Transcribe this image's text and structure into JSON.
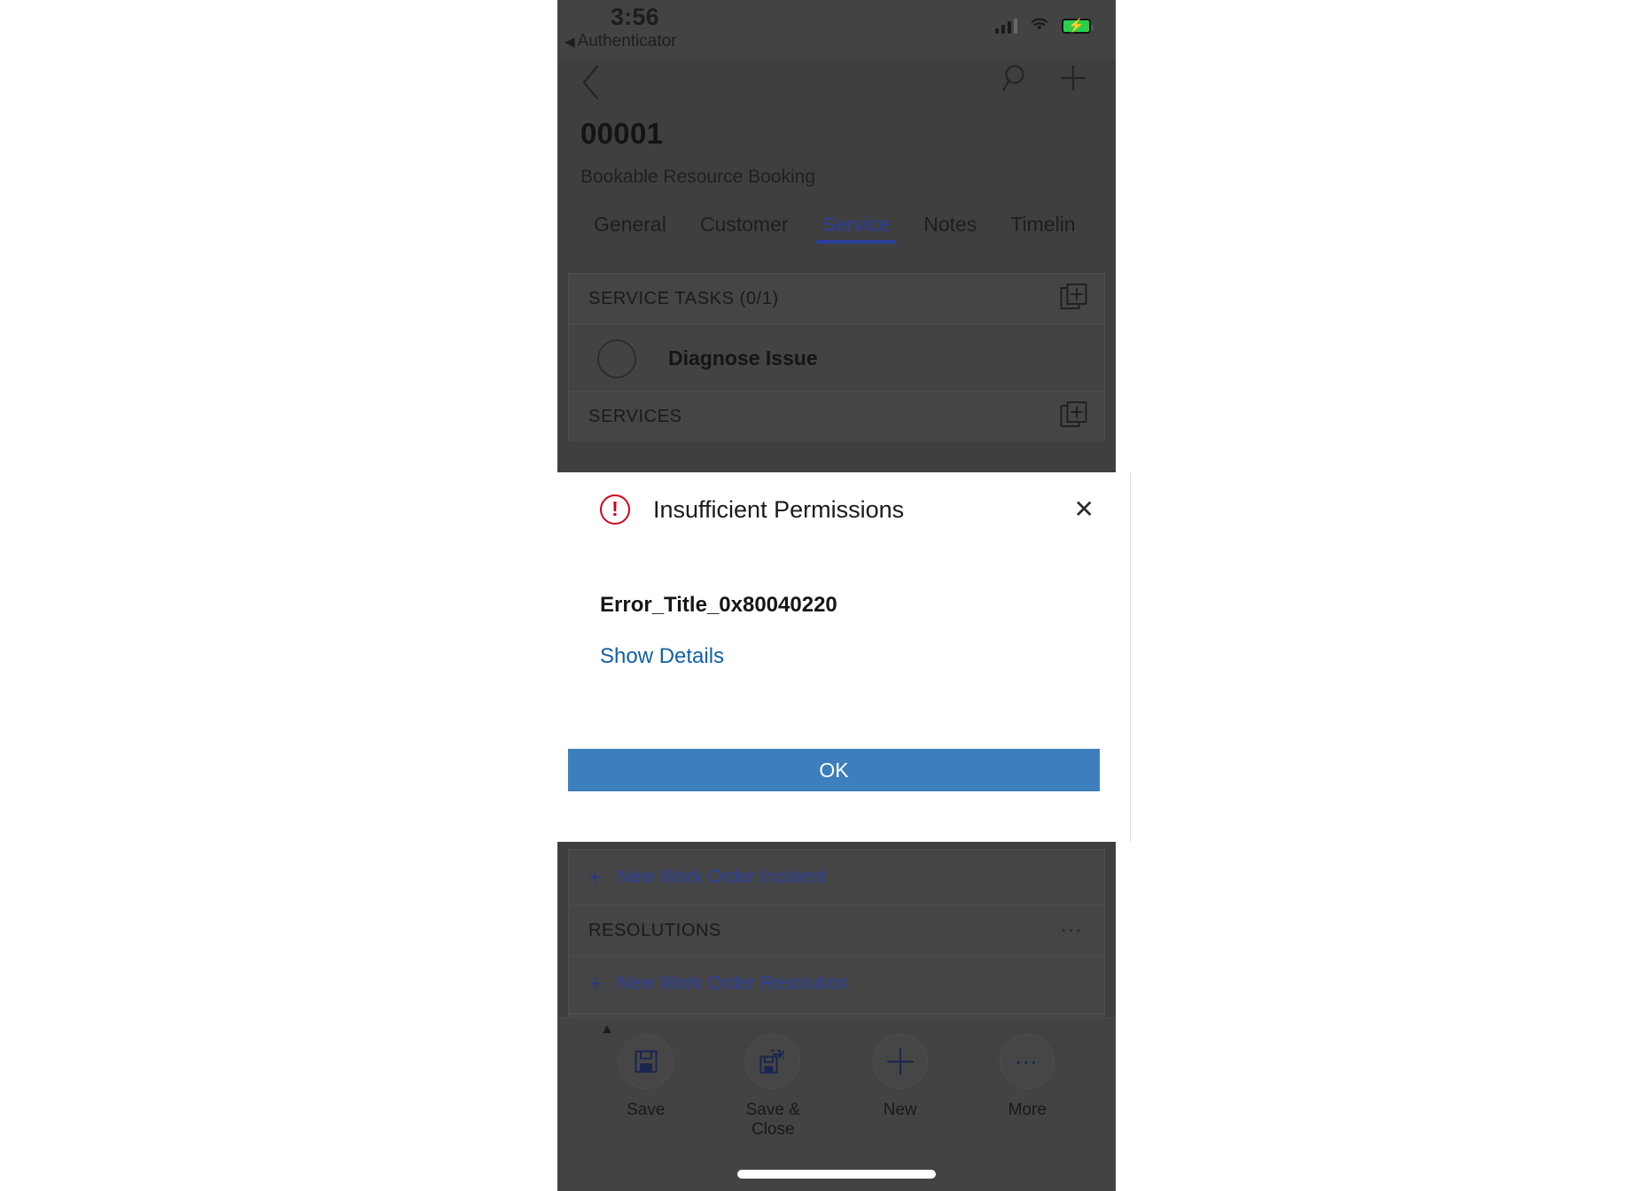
{
  "status_bar": {
    "time": "3:56",
    "back_app_label": "Authenticator",
    "back_triangle": "◀",
    "signal_icon": "signal-bars-icon",
    "wifi_icon": "wifi-icon",
    "battery_icon": "battery-charging-icon",
    "battery_color": "#2bd04a"
  },
  "command_icons": {
    "back": "‹",
    "search": "search-icon",
    "new": "+"
  },
  "record": {
    "title": "00001",
    "entity": "Bookable Resource Booking"
  },
  "tabs": [
    {
      "label": "General",
      "active": false
    },
    {
      "label": "Customer",
      "active": false
    },
    {
      "label": "Service",
      "active": true
    },
    {
      "label": "Notes",
      "active": false
    },
    {
      "label": "Timelin",
      "active": false
    }
  ],
  "sections": {
    "service_tasks": {
      "header": "SERVICE TASKS (0/1)",
      "add_icon": "add-existing-record-icon",
      "rows": [
        {
          "label": "Diagnose Issue",
          "completed": false
        }
      ]
    },
    "services": {
      "header": "SERVICES",
      "add_icon": "add-existing-record-icon"
    },
    "incidents": {
      "new_link": "New Work Order Incident",
      "plus": "+"
    },
    "resolutions": {
      "header": "RESOLUTIONS",
      "more_icon": "ellipsis-icon",
      "new_link": "New Work Order Resolution",
      "plus": "+"
    }
  },
  "dialog": {
    "error_icon": "error-exclamation-icon",
    "error_icon_color": "#d0021b",
    "title": "Insufficient Permissions",
    "close_icon": "✕",
    "error_code": "Error_Title_0x80040220",
    "details_link": "Show Details",
    "ok_label": "OK",
    "ok_color": "#3d7ebc",
    "link_color": "#1160a8"
  },
  "bottom_bar": {
    "expand_icon": "chevron-up-icon",
    "items": [
      {
        "label": "Save",
        "icon": "save-floppy-icon"
      },
      {
        "label": "Save & Close",
        "icon": "save-and-close-icon"
      },
      {
        "label": "New",
        "icon": "plus-icon"
      },
      {
        "label": "More",
        "icon": "ellipsis-icon"
      }
    ],
    "home_indicator": "home-indicator"
  },
  "accent_colors": {
    "tab_active": "#2b3f9e",
    "link": "#2b3f9e",
    "dialog_button": "#3d7ebc",
    "error": "#d0021b"
  }
}
